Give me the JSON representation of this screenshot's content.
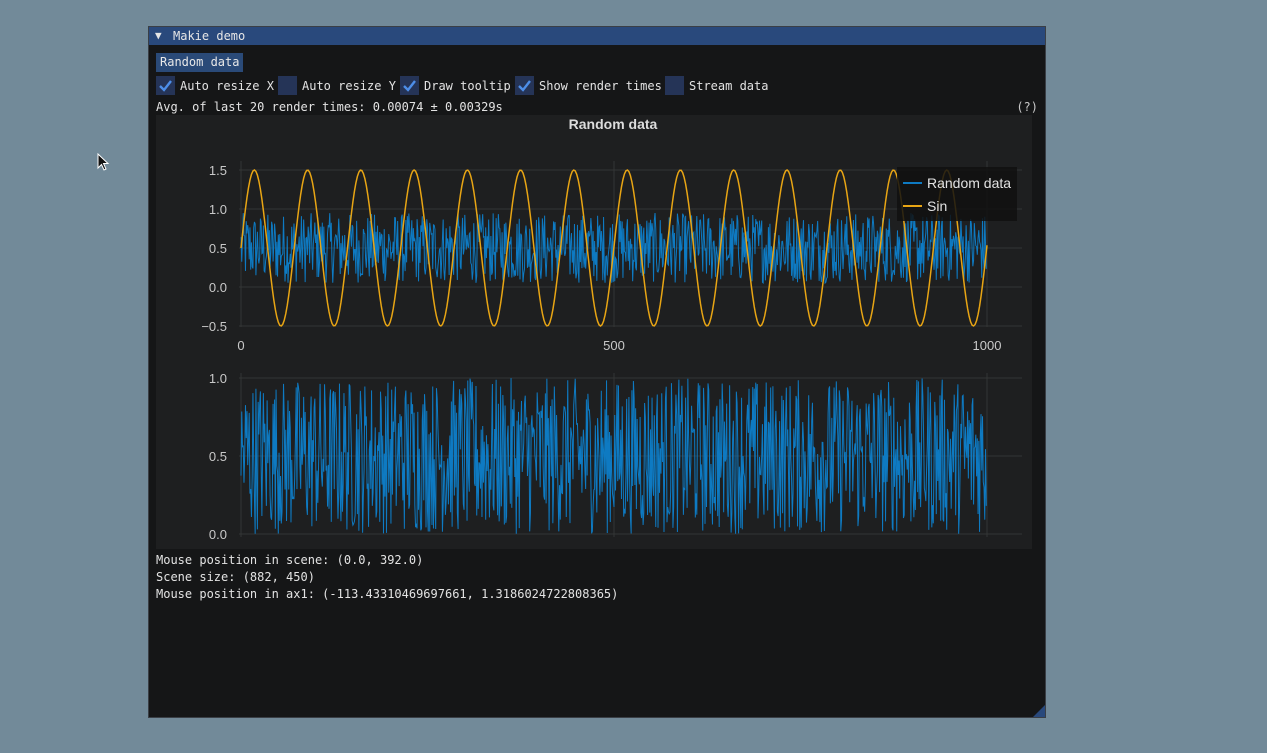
{
  "window": {
    "title": "Makie demo",
    "collapse_icon": "triangle-down-icon"
  },
  "toolbar": {
    "random_button": "Random data"
  },
  "checkboxes": [
    {
      "label": "Auto resize X",
      "checked": true
    },
    {
      "label": "Auto resize Y",
      "checked": false
    },
    {
      "label": "Draw tooltip",
      "checked": true
    },
    {
      "label": "Show render times",
      "checked": true
    },
    {
      "label": "Stream data",
      "checked": false
    }
  ],
  "stats": {
    "render_times": "Avg. of last 20 render times: 0.00074 ± 0.00329s",
    "help": "(?)"
  },
  "info": {
    "mouse_scene": "Mouse position in scene: (0.0, 392.0)",
    "scene_size": "Scene size: (882, 450)",
    "mouse_ax1": "Mouse position in ax1: (-113.43310469697661, 1.3186024722808365)"
  },
  "colors": {
    "series_random": "#0e7ac2",
    "series_sin": "#e8a514",
    "accent": "#29497c"
  },
  "chart_data": [
    {
      "type": "line",
      "title": "Random data",
      "xlim": [
        0,
        1000
      ],
      "ylim": [
        -0.6,
        1.6
      ],
      "x_ticks": [
        "0",
        "500",
        "1000"
      ],
      "y_ticks": [
        "1.5",
        "1.0",
        "0.5",
        "0.0",
        "−0.5"
      ],
      "legend": "top-right",
      "series": [
        {
          "name": "Random data",
          "n_points": 1000,
          "min": 0,
          "max": 1
        },
        {
          "name": "Sin",
          "amplitude": 1,
          "offset": 0.5,
          "period": 71.4,
          "x_range": [
            0,
            1000
          ]
        }
      ]
    },
    {
      "type": "line",
      "xlim": [
        0,
        1000
      ],
      "ylim": [
        -0.02,
        1.02
      ],
      "x_ticks": [
        "0",
        "500",
        "1000"
      ],
      "y_ticks": [
        "1.0",
        "0.5",
        "0.0"
      ],
      "series": [
        {
          "n_points": 1000,
          "min": 0,
          "max": 1
        }
      ]
    }
  ]
}
